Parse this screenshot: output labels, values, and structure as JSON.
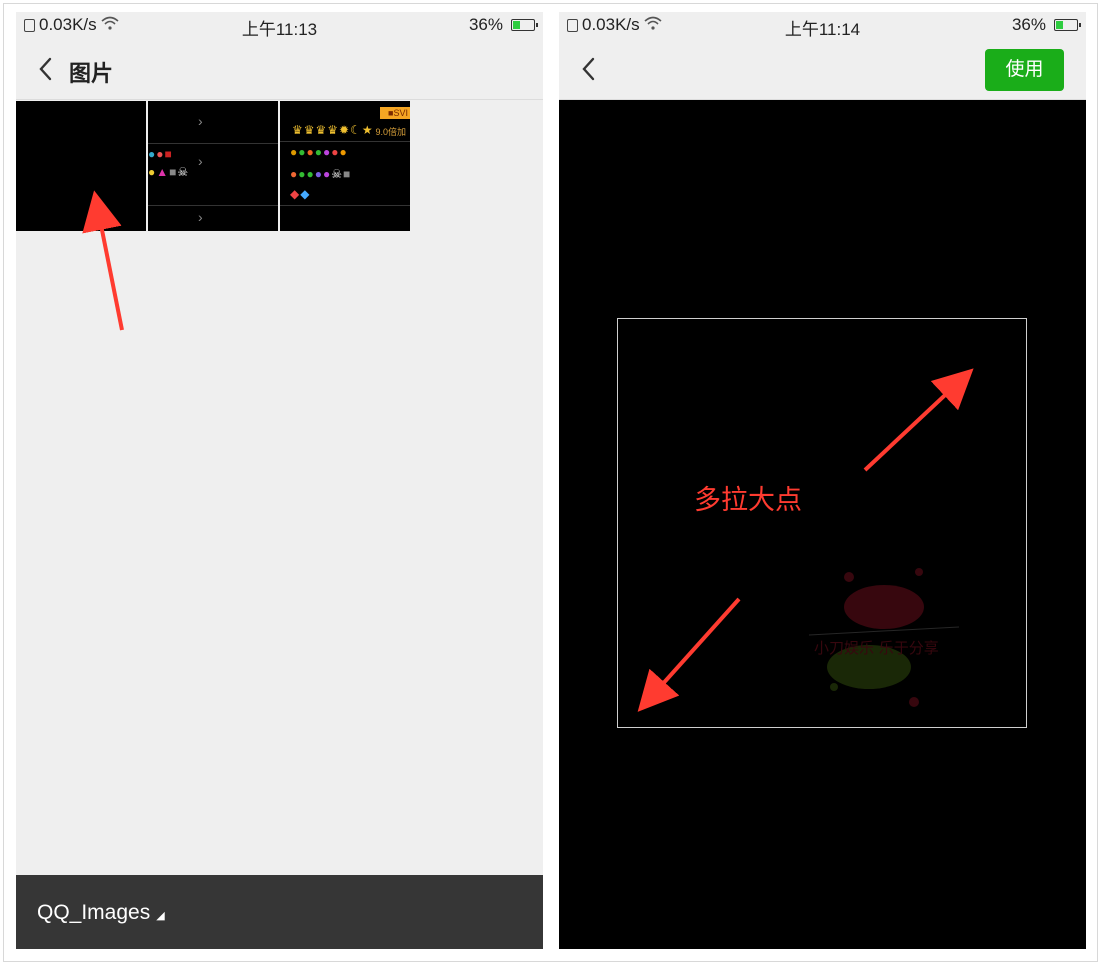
{
  "left_screen": {
    "status": {
      "speed": "0.03K/s",
      "time": "上午11:13",
      "battery": "36%",
      "battery_level": 0.36
    },
    "nav": {
      "title": "图片",
      "back_icon": "chevron-left-icon"
    },
    "thumbnails": [
      {
        "name": "black-image"
      },
      {
        "name": "emoji-list-screenshot"
      },
      {
        "name": "emoji-panel-screenshot",
        "badge": "9.0倍加",
        "tag": "■SVI"
      }
    ],
    "album": {
      "label": "QQ_Images",
      "icon": "triangle-down-icon"
    }
  },
  "right_screen": {
    "status": {
      "speed": "0.03K/s",
      "time": "上午11:14",
      "battery": "36%",
      "battery_level": 0.36
    },
    "nav": {
      "use_label": "使用",
      "back_icon": "chevron-left-icon"
    },
    "annotation": "多拉大点",
    "watermark_text": "小刀娱乐 乐于分享"
  },
  "colors": {
    "accent": "#1aad19",
    "annotation": "#ff3b30",
    "bottom_bar": "#363636",
    "nav_bg": "#efefef"
  }
}
